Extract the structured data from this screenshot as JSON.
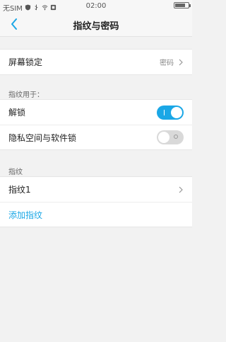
{
  "status_bar": {
    "carrier": "无SIM",
    "time": "02:00",
    "icons": [
      "shield-icon",
      "usb-icon",
      "wifi-icon",
      "notification-icon"
    ]
  },
  "header": {
    "title": "指纹与密码",
    "back_icon": "chevron-left-icon"
  },
  "colors": {
    "accent": "#1aa7e6",
    "background": "#f2f2f2"
  },
  "screen_lock": {
    "label": "屏幕锁定",
    "value": "密码"
  },
  "fingerprint_usage": {
    "section_label": "指纹用于：",
    "items": [
      {
        "label": "解锁",
        "enabled": true
      },
      {
        "label": "隐私空间与软件锁",
        "enabled": false
      }
    ]
  },
  "fingerprints": {
    "section_label": "指纹",
    "items": [
      {
        "label": "指纹1"
      }
    ],
    "add_label": "添加指纹"
  }
}
